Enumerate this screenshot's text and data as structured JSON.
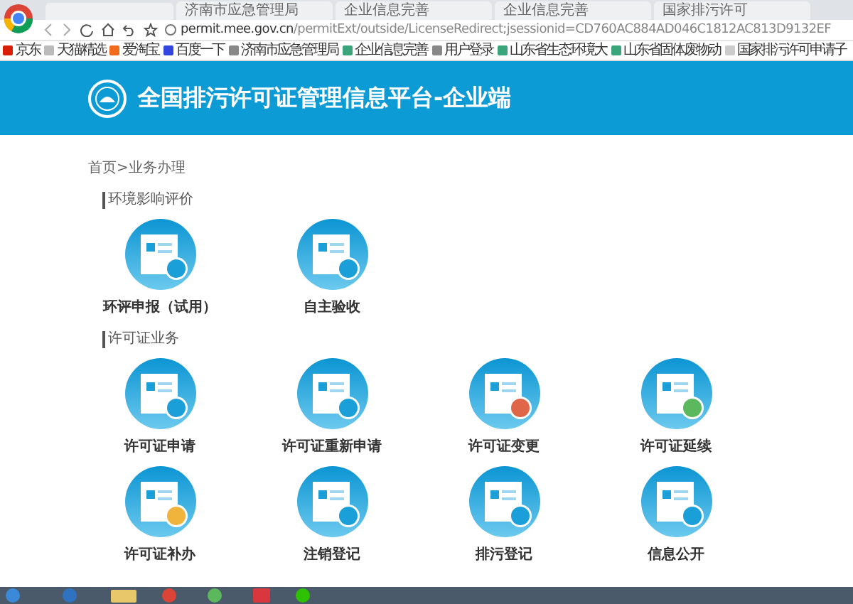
{
  "browser": {
    "tabs": [
      {
        "title": "济南市应急管理局",
        "selected": false
      },
      {
        "title": "企业信息完善",
        "selected": false
      },
      {
        "title": "企业信息完善",
        "selected": false
      },
      {
        "title": "国家排污许可",
        "selected": false
      }
    ],
    "address": {
      "host": "permit.mee.gov.cn",
      "path": "/permitExt/outside/LicenseRedirect;jsessionid=CD760AC884AD046C1812AC813D9132EF"
    },
    "bookmarks": [
      {
        "label": "京东",
        "color": "#d81e06"
      },
      {
        "label": "天猫精选",
        "color": "#bbbbbb"
      },
      {
        "label": "爱淘宝",
        "color": "#f26b1d"
      },
      {
        "label": "百度一下",
        "color": "#3245df"
      },
      {
        "label": "济南市应急管理局",
        "color": "#888888"
      },
      {
        "label": "企业信息完善",
        "color": "#3aa57a"
      },
      {
        "label": "用户登录",
        "color": "#888888"
      },
      {
        "label": "山东省生态环境大",
        "color": "#3aa57a"
      },
      {
        "label": "山东省固体废物动",
        "color": "#3aa57a"
      },
      {
        "label": "国家排污许可申请子",
        "color": "#cccccc"
      }
    ]
  },
  "header": {
    "title": "全国排污许可证管理信息平台-企业端"
  },
  "breadcrumb": "首页>业务办理",
  "sections": [
    {
      "title": "环境影响评价",
      "items": [
        {
          "label": "环评申报（试用）",
          "color": "#1a9fd8"
        },
        {
          "label": "自主验收",
          "color": "#1a9fd8"
        }
      ]
    },
    {
      "title": "许可证业务",
      "items": [
        {
          "label": "许可证申请",
          "color": "#1a9fd8"
        },
        {
          "label": "许可证重新申请",
          "color": "#1a9fd8"
        },
        {
          "label": "许可证变更",
          "color": "#e0664a"
        },
        {
          "label": "许可证延续",
          "color": "#5cb85c"
        },
        {
          "label": "许可证补办",
          "color": "#f0b43c"
        },
        {
          "label": "注销登记",
          "color": "#1a9fd8"
        },
        {
          "label": "排污登记",
          "color": "#1a9fd8"
        },
        {
          "label": "信息公开",
          "color": "#1a9fd8"
        }
      ]
    }
  ]
}
